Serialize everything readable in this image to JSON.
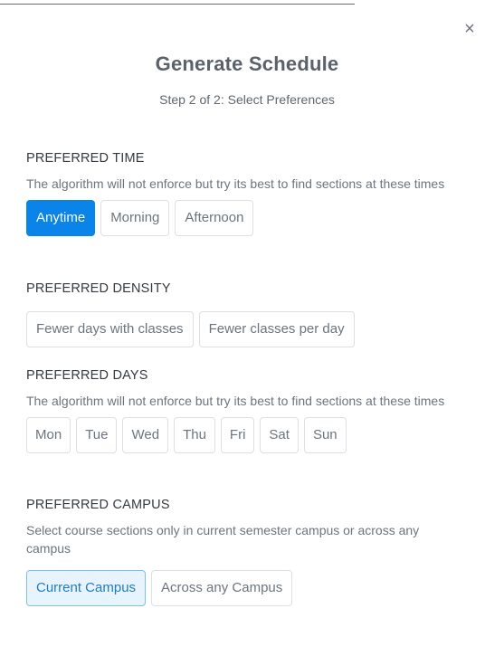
{
  "dialog": {
    "close_glyph": "×",
    "title": "Generate Schedule",
    "subtitle": "Step 2 of 2: Select Preferences"
  },
  "preferred_time": {
    "label": "PREFERRED TIME",
    "description": "The algorithm will not enforce but try its best to find sections at these times",
    "options": [
      "Anytime",
      "Morning",
      "Afternoon"
    ],
    "selected": "Anytime"
  },
  "preferred_density": {
    "label": "PREFERRED DENSITY",
    "options": [
      "Fewer days with classes",
      "Fewer classes per day"
    ],
    "selected": null
  },
  "preferred_days": {
    "label": "PREFERRED DAYS",
    "description": "The algorithm will not enforce but try its best to find sections at these times",
    "options": [
      "Mon",
      "Tue",
      "Wed",
      "Thu",
      "Fri",
      "Sat",
      "Sun"
    ],
    "selected": []
  },
  "preferred_campus": {
    "label": "PREFERRED CAMPUS",
    "description": "Select course sections only in current semester campus or across any campus",
    "options": [
      "Current Campus",
      "Across any Campus"
    ],
    "selected": "Current Campus"
  },
  "colors": {
    "accent": "#0a84e8",
    "accent_soft_bg": "#e8f4fd",
    "accent_soft_border": "#7fbfe8"
  }
}
